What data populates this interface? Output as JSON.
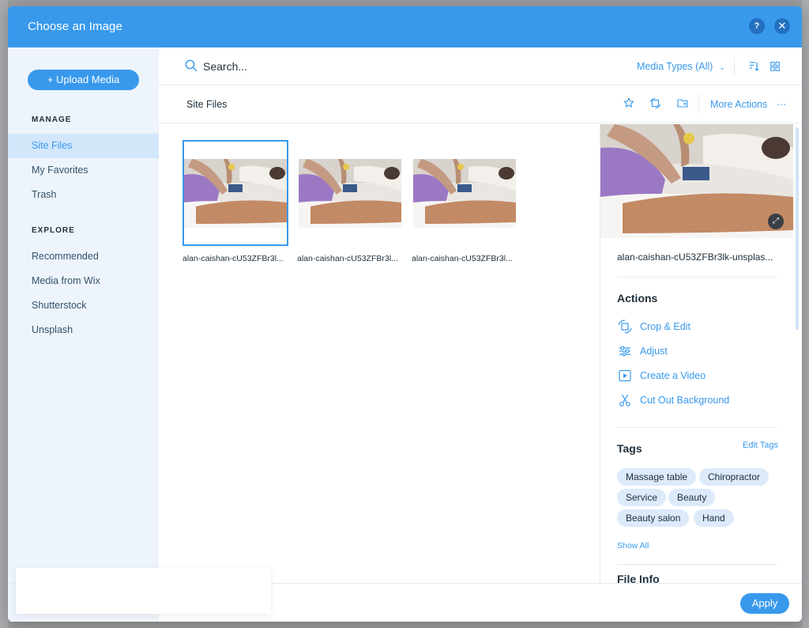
{
  "dialog": {
    "title": "Choose an Image",
    "help_label": "?",
    "close_label": "✕"
  },
  "sidebar": {
    "upload_label": "+ Upload Media",
    "manage_label": "MANAGE",
    "manage_items": [
      {
        "label": "Site Files",
        "active": true
      },
      {
        "label": "My Favorites",
        "active": false
      },
      {
        "label": "Trash",
        "active": false
      }
    ],
    "explore_label": "EXPLORE",
    "explore_items": [
      {
        "label": "Recommended"
      },
      {
        "label": "Media from Wix"
      },
      {
        "label": "Shutterstock"
      },
      {
        "label": "Unsplash"
      }
    ]
  },
  "toolbar": {
    "search_placeholder": "Search...",
    "media_types_label": "Media Types (All)",
    "sort_icon": "sort-icon",
    "grid_icon": "grid-view-icon"
  },
  "folder": {
    "title": "Site Files",
    "more_actions_label": "More Actions",
    "more_actions_dots": "···"
  },
  "files": [
    {
      "name": "alan-caishan-cU53ZFBr3l...",
      "selected": true
    },
    {
      "name": "alan-caishan-cU53ZFBr3l...",
      "selected": false
    },
    {
      "name": "alan-caishan-cU53ZFBr3l...",
      "selected": false
    }
  ],
  "details": {
    "file_name": "alan-caishan-cU53ZFBr3lk-unsplas...",
    "actions_title": "Actions",
    "actions": [
      {
        "label": "Crop & Edit",
        "icon": "crop-icon"
      },
      {
        "label": "Adjust",
        "icon": "adjust-icon"
      },
      {
        "label": "Create a Video",
        "icon": "video-icon"
      },
      {
        "label": "Cut Out Background",
        "icon": "scissors-icon"
      }
    ],
    "tags_title": "Tags",
    "edit_tags_label": "Edit Tags",
    "tags": [
      "Massage table",
      "Chiropractor",
      "Service",
      "Beauty",
      "Beauty salon",
      "Hand"
    ],
    "show_all_label": "Show All",
    "file_info_title": "File Info"
  },
  "footer": {
    "apply_label": "Apply"
  },
  "colors": {
    "accent": "#3899ec",
    "sidebar_bg": "#eef4fb",
    "selected_nav_bg": "#d3e7fb",
    "tag_bg": "#dceafa"
  }
}
